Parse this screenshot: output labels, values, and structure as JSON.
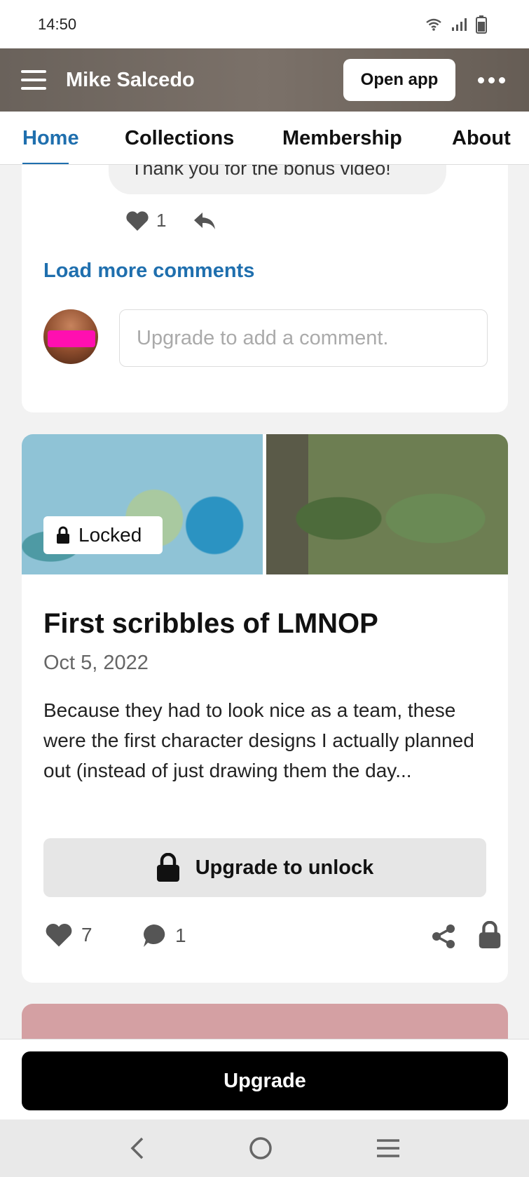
{
  "status_bar": {
    "time": "14:50"
  },
  "header": {
    "title": "Mike Salcedo",
    "open_app_label": "Open app"
  },
  "tabs": [
    {
      "label": "Home",
      "active": true
    },
    {
      "label": "Collections"
    },
    {
      "label": "Membership"
    },
    {
      "label": "About"
    }
  ],
  "comment": {
    "text": "Thank you for the bonus video!",
    "like_count": "1"
  },
  "load_more_label": "Load more comments",
  "comment_input": {
    "placeholder": "Upgrade to add a comment."
  },
  "post": {
    "badge": "Locked",
    "title": "First scribbles of LMNOP",
    "date": "Oct 5, 2022",
    "excerpt": "Because they had to look nice as a team, these were the first character designs I actually planned out (instead of just drawing them the day...",
    "unlock_label": "Upgrade to unlock",
    "like_count": "7",
    "comment_count": "1"
  },
  "upgrade_label": "Upgrade",
  "colors": {
    "accent": "#1f6fae",
    "header_bg": "#6f665e",
    "upgrade_bg": "#000000"
  },
  "icons": [
    "wifi-icon",
    "signal-icon",
    "battery-icon",
    "menu-icon",
    "more-icon",
    "heart-icon",
    "reply-icon",
    "lock-icon",
    "comment-icon",
    "share-icon",
    "back-icon",
    "home-icon",
    "recents-icon"
  ]
}
